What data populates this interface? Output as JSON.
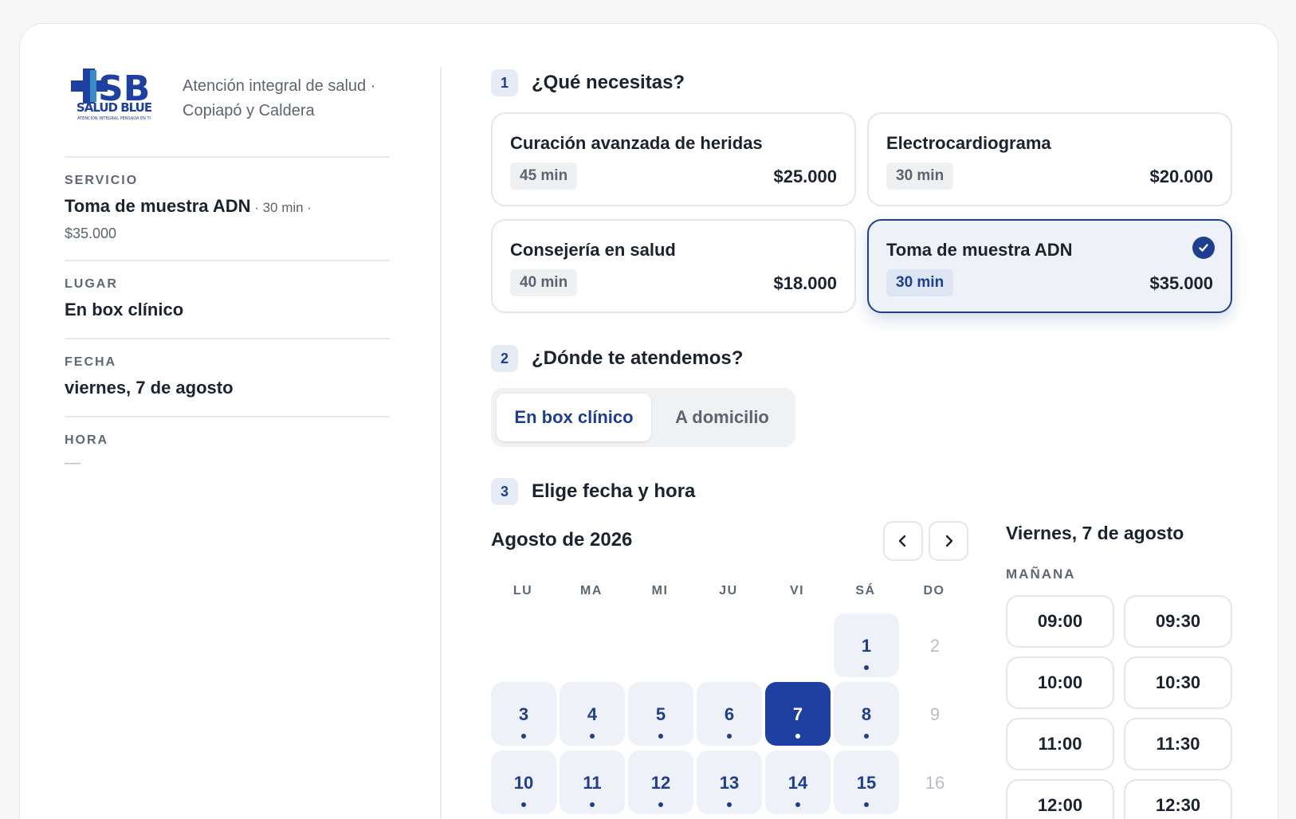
{
  "brand": {
    "logo_text": "SALUD BLUE",
    "logo_tagline": "ATENCIÓN INTEGRAL PENSADA EN TI",
    "tagline": "Atención integral de salud · Copiapó y Caldera"
  },
  "summary": {
    "service_label": "SERVICIO",
    "service_value": "Toma de muestra ADN",
    "service_meta": " · 30 min ·",
    "service_price": "$35.000",
    "place_label": "LUGAR",
    "place_value": "En box clínico",
    "date_label": "FECHA",
    "date_value": "viernes, 7 de agosto",
    "time_label": "HORA",
    "time_value": "—"
  },
  "step1": {
    "num": "1",
    "title": "¿Qué necesitas?",
    "services": [
      {
        "name": "Curación avanzada de heridas",
        "duration": "45 min",
        "price": "$25.000",
        "selected": false
      },
      {
        "name": "Electrocardiograma",
        "duration": "30 min",
        "price": "$20.000",
        "selected": false
      },
      {
        "name": "Consejería en salud",
        "duration": "40 min",
        "price": "$18.000",
        "selected": false
      },
      {
        "name": "Toma de muestra ADN",
        "duration": "30 min",
        "price": "$35.000",
        "selected": true
      }
    ]
  },
  "step2": {
    "num": "2",
    "title": "¿Dónde te atendemos?",
    "options": [
      "En box clínico",
      "A domicilio"
    ],
    "selected": "En box clínico"
  },
  "step3": {
    "num": "3",
    "title": "Elige fecha y hora",
    "month": "Agosto de 2026",
    "weekdays": [
      "LU",
      "MA",
      "MI",
      "JU",
      "VI",
      "SÁ",
      "DO"
    ],
    "days": [
      {
        "d": "1",
        "state": "available"
      },
      {
        "d": "2",
        "state": "off"
      },
      {
        "d": "3",
        "state": "available"
      },
      {
        "d": "4",
        "state": "available"
      },
      {
        "d": "5",
        "state": "available"
      },
      {
        "d": "6",
        "state": "available"
      },
      {
        "d": "7",
        "state": "selected"
      },
      {
        "d": "8",
        "state": "available"
      },
      {
        "d": "9",
        "state": "off"
      },
      {
        "d": "10",
        "state": "available"
      },
      {
        "d": "11",
        "state": "available"
      },
      {
        "d": "12",
        "state": "available"
      },
      {
        "d": "13",
        "state": "available"
      },
      {
        "d": "14",
        "state": "available"
      },
      {
        "d": "15",
        "state": "available"
      },
      {
        "d": "16",
        "state": "off"
      }
    ],
    "slots_date": "Viernes, 7 de agosto",
    "slots_period": "MAÑANA",
    "slots": [
      "09:00",
      "09:30",
      "10:00",
      "10:30",
      "11:00",
      "11:30",
      "12:00",
      "12:30"
    ]
  },
  "colors": {
    "accent": "#1e3f8f",
    "accent_bg": "#eef2f8",
    "border": "#e3e6ea"
  },
  "icons": {
    "prev": "chevron-left-icon",
    "next": "chevron-right-icon",
    "check": "check-circle-icon"
  }
}
